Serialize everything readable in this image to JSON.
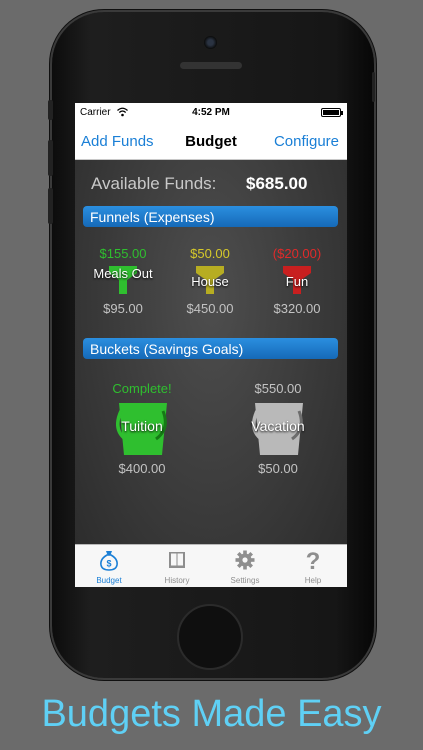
{
  "status_bar": {
    "carrier": "Carrier",
    "time": "4:52 PM"
  },
  "nav_bar": {
    "left_button": "Add Funds",
    "title": "Budget",
    "right_button": "Configure"
  },
  "available_funds": {
    "label": "Available Funds:",
    "value": "$685.00"
  },
  "funnels_section": {
    "title": "Funnels (Expenses)"
  },
  "funnels": [
    {
      "name": "Meals Out",
      "top_value": "$155.00",
      "bottom_value": "$95.00",
      "color": "#2fbf2f"
    },
    {
      "name": "House",
      "top_value": "$50.00",
      "bottom_value": "$450.00",
      "color": "#d6c92a"
    },
    {
      "name": "Fun",
      "top_value": "($20.00)",
      "bottom_value": "$320.00",
      "color": "#d82626"
    }
  ],
  "buckets_section": {
    "title": "Buckets (Savings Goals)"
  },
  "buckets": [
    {
      "name": "Tuition",
      "top_value": "Complete!",
      "bottom_value": "$400.00",
      "color": "#2fbf2f"
    },
    {
      "name": "Vacation",
      "top_value": "$550.00",
      "bottom_value": "$50.00",
      "color": "#bdbdbd"
    }
  ],
  "tab_bar": [
    {
      "label": "Budget",
      "icon": "money-bag-icon",
      "active": true
    },
    {
      "label": "History",
      "icon": "book-icon"
    },
    {
      "label": "Settings",
      "icon": "gear-icon"
    },
    {
      "label": "Help",
      "icon": "question-mark-icon"
    }
  ],
  "caption": "Budgets Made Easy",
  "colors": {
    "accent_blue": "#1a7fd6",
    "caption": "#5fd0f5",
    "background": "#6b6b6b"
  }
}
